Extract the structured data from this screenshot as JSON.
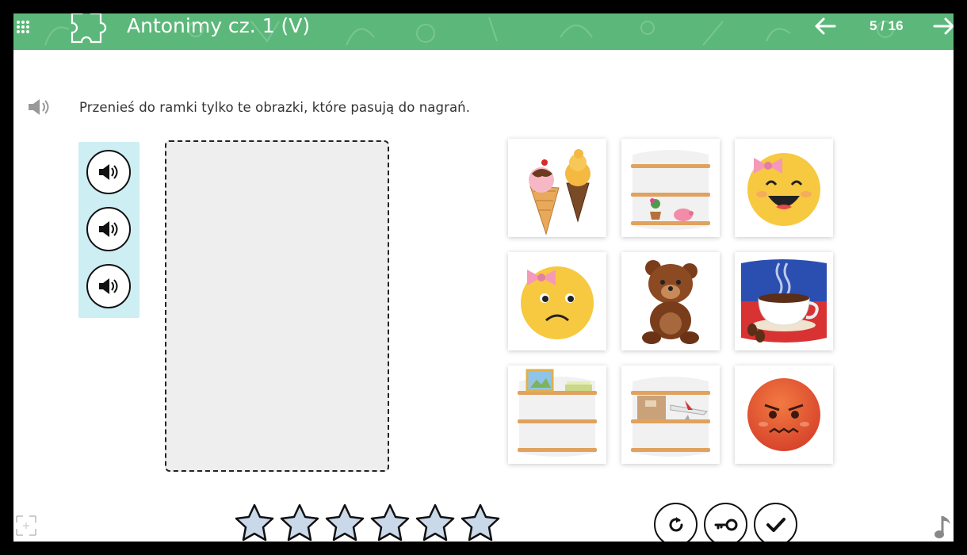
{
  "header": {
    "title": "Antonimy cz. 1 (V)",
    "page_counter": "5 / 16",
    "background_color": "#5cb87a"
  },
  "instruction": {
    "text": "Przenieś do ramki tylko te obrazki, które pasują do nagrań."
  },
  "audio_buttons": [
    {
      "icon": "speaker-icon"
    },
    {
      "icon": "speaker-icon"
    },
    {
      "icon": "speaker-icon"
    }
  ],
  "drop_zone": {
    "state": "empty"
  },
  "cards": [
    {
      "subject": "ice-cream-cones"
    },
    {
      "subject": "shelves-with-plant-and-piggy-bank"
    },
    {
      "subject": "laughing-emoji-with-bow"
    },
    {
      "subject": "sad-emoji-with-bow"
    },
    {
      "subject": "teddy-bear"
    },
    {
      "subject": "hot-coffee-cup"
    },
    {
      "subject": "shelves-with-picture-and-book"
    },
    {
      "subject": "shelves-with-box-and-airplane"
    },
    {
      "subject": "angry-red-emoji"
    }
  ],
  "stars": {
    "total": 6,
    "earned": 0
  },
  "controls": [
    {
      "name": "reset",
      "icon": "reset-icon"
    },
    {
      "name": "show-answers",
      "icon": "key-icon"
    },
    {
      "name": "check",
      "icon": "check-icon"
    }
  ],
  "colors": {
    "audio_panel": "#cdeef2",
    "drop_zone": "#eeeeee",
    "star": "#c9d9ea"
  }
}
